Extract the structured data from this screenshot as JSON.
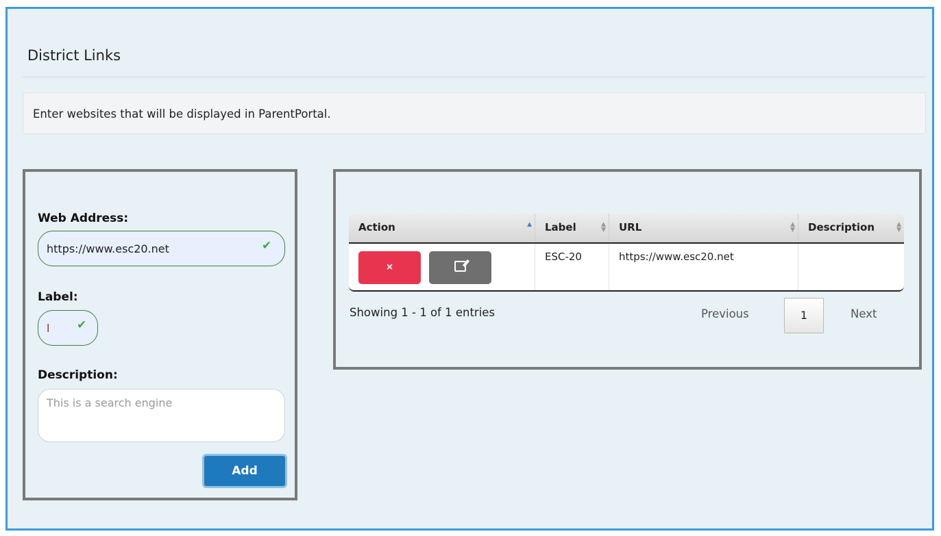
{
  "page": {
    "title": "District Links",
    "info": "Enter websites that will be displayed in ParentPortal."
  },
  "form": {
    "web_address_label": "Web Address:",
    "web_address_value": "https://www.esc20.net",
    "label_label": "Label:",
    "label_value": "l",
    "description_label": "Description:",
    "description_placeholder": "This is a search engine",
    "add_label": "Add",
    "valid_icon": "checkmark-icon"
  },
  "table": {
    "columns": [
      "Action",
      "Label",
      "URL",
      "Description"
    ],
    "rows": [
      {
        "label": "ESC-20",
        "url": "https://www.esc20.net",
        "description": ""
      }
    ],
    "delete_icon": "×",
    "edit_icon": "edit-icon"
  },
  "pagination": {
    "showing": "Showing 1 - 1 of 1 entries",
    "previous": "Previous",
    "page": "1",
    "next": "Next"
  },
  "colors": {
    "frame_border": "#3d9be0",
    "delete_button": "#e8344e",
    "edit_button": "#6f6f6f",
    "add_button": "#1f79bd",
    "valid_border": "#3f7f3f",
    "check": "#3caa3c"
  }
}
